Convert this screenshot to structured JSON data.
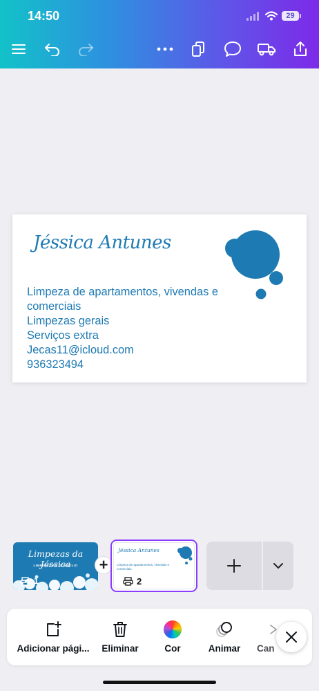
{
  "status_bar": {
    "time": "14:50",
    "battery": "29"
  },
  "toolbar": {
    "icons": [
      "menu-icon",
      "undo-icon",
      "redo-icon",
      "more-icon",
      "pages-icon",
      "comment-icon",
      "truck-icon",
      "share-icon"
    ]
  },
  "card": {
    "name": "Jéssica Antunes",
    "lines": [
      "Limpeza de apartamentos, vivendas e",
      "comerciais",
      "Limpezas gerais",
      "Serviços extra",
      "Jecas11@icloud.com",
      "936323494"
    ],
    "accent_color": "#1e7ab3"
  },
  "pages": [
    {
      "title": "Limpezas da Jéssica",
      "subtitle": "LIMPEZAS AO DOMICÍLIO",
      "number": "1"
    },
    {
      "title": "Jéssica Antunes",
      "lines": [
        "Limpeza de apartamentos, vivendas e",
        "comerciais"
      ],
      "number": "2",
      "selected": true
    }
  ],
  "bottom_bar": {
    "items": [
      {
        "label": "Adicionar pági...",
        "icon": "add-page-icon"
      },
      {
        "label": "Eliminar",
        "icon": "trash-icon"
      },
      {
        "label": "Cor",
        "icon": "color-wheel-icon"
      },
      {
        "label": "Animar",
        "icon": "animate-icon"
      },
      {
        "label": "Can",
        "icon": "cancel-icon"
      }
    ]
  },
  "colors": {
    "brand_purple": "#8b3dff",
    "header_start": "#12c2c9",
    "header_end": "#7d2ae8"
  }
}
